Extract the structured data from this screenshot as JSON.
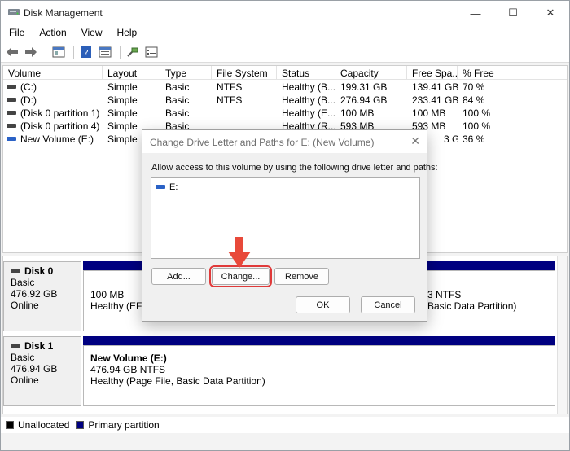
{
  "window": {
    "title": "Disk Management",
    "controls": {
      "minimize": "—",
      "maximize": "☐",
      "close": "✕"
    }
  },
  "menu": {
    "items": [
      "File",
      "Action",
      "View",
      "Help"
    ]
  },
  "volume_table": {
    "columns": [
      "Volume",
      "Layout",
      "Type",
      "File System",
      "Status",
      "Capacity",
      "Free Spa...",
      "% Free"
    ],
    "rows": [
      {
        "volume": "(C:)",
        "layout": "Simple",
        "type": "Basic",
        "fs": "NTFS",
        "status": "Healthy (B...",
        "capacity": "199.31 GB",
        "free": "139.41 GB",
        "pct": "70 %"
      },
      {
        "volume": "(D:)",
        "layout": "Simple",
        "type": "Basic",
        "fs": "NTFS",
        "status": "Healthy (B...",
        "capacity": "276.94 GB",
        "free": "233.41 GB",
        "pct": "84 %"
      },
      {
        "volume": "(Disk 0 partition 1)",
        "layout": "Simple",
        "type": "Basic",
        "fs": "",
        "status": "Healthy (E...",
        "capacity": "100 MB",
        "free": "100 MB",
        "pct": "100 %"
      },
      {
        "volume": "(Disk 0 partition 4)",
        "layout": "Simple",
        "type": "Basic",
        "fs": "",
        "status": "Healthy (R...",
        "capacity": "593 MB",
        "free": "593 MB",
        "pct": "100 %"
      },
      {
        "volume": "New Volume (E:)",
        "layout": "Simple",
        "type": "",
        "fs": "",
        "status": "",
        "capacity": "",
        "free": "3 GB",
        "pct": "36 %"
      }
    ]
  },
  "disks": [
    {
      "name": "Disk 0",
      "type": "Basic",
      "size": "476.92 GB",
      "state": "Online",
      "part1": {
        "size": "100 MB",
        "status": "Healthy (EFI"
      },
      "part2": {
        "size": "3 NTFS",
        "status": "Basic Data Partition)"
      }
    },
    {
      "name": "Disk 1",
      "type": "Basic",
      "size": "476.94 GB",
      "state": "Online",
      "part1": {
        "title": "New Volume  (E:)",
        "size": "476.94 GB NTFS",
        "status": "Healthy (Page File, Basic Data Partition)"
      }
    }
  ],
  "legend": [
    {
      "label": "Unallocated",
      "color": "#000000"
    },
    {
      "label": "Primary partition",
      "color": "#000080"
    }
  ],
  "dialog": {
    "title": "Change Drive Letter and Paths for E: (New Volume)",
    "close": "✕",
    "description": "Allow access to this volume by using the following drive letter and paths:",
    "entries": [
      "E:"
    ],
    "buttons": {
      "add": "Add...",
      "change": "Change...",
      "remove": "Remove",
      "ok": "OK",
      "cancel": "Cancel"
    }
  },
  "colors": {
    "annotation_arrow": "#e8493a",
    "highlight": "#e03a3a",
    "primary_partition": "#000080"
  }
}
